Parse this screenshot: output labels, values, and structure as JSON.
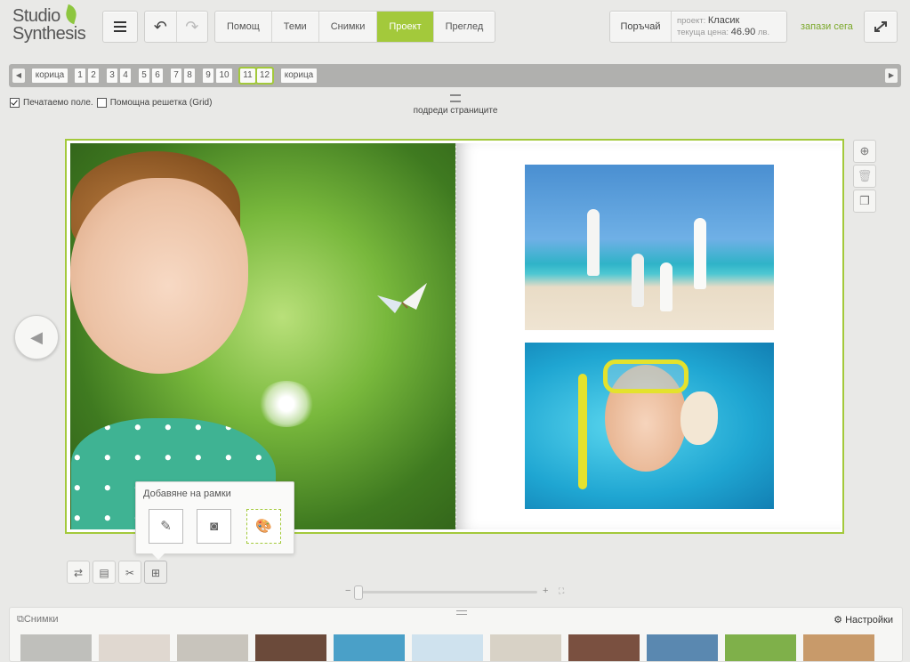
{
  "app": {
    "logo_line1": "Studio",
    "logo_line2": "Synthesis"
  },
  "toolbar": {
    "menu_icon": "hamburger-icon",
    "undo_icon": "undo-icon",
    "redo_icon": "redo-icon",
    "tabs": [
      {
        "label": "Помощ",
        "active": false
      },
      {
        "label": "Теми",
        "active": false
      },
      {
        "label": "Снимки",
        "active": false
      },
      {
        "label": "Проект",
        "active": true
      },
      {
        "label": "Преглед",
        "active": false
      }
    ],
    "order_label": "Поръчай",
    "project_label": "проект:",
    "project_value": "Класик",
    "price_label": "текуща цена:",
    "price_value": "46.90",
    "price_unit": "лв.",
    "save_now": "запази сега",
    "accent_color": "#a3c93b"
  },
  "pages_strip": {
    "items": [
      "корица",
      "1",
      "2",
      "3",
      "4",
      "5",
      "6",
      "7",
      "8",
      "9",
      "10",
      "11",
      "12",
      "корица"
    ],
    "selected": [
      "11",
      "12"
    ]
  },
  "options": {
    "printable_field_label": "Печатаемо поле.",
    "printable_field_checked": true,
    "grid_label": "Помощна решетка (Grid)",
    "grid_checked": false,
    "arrange_label": "подреди страниците"
  },
  "popup": {
    "title": "Добавяне на рамки",
    "buttons": [
      "pencil-icon",
      "camera-icon",
      "palette-icon"
    ]
  },
  "photos_panel": {
    "title": "Снимки",
    "settings_label": "Настройки"
  }
}
